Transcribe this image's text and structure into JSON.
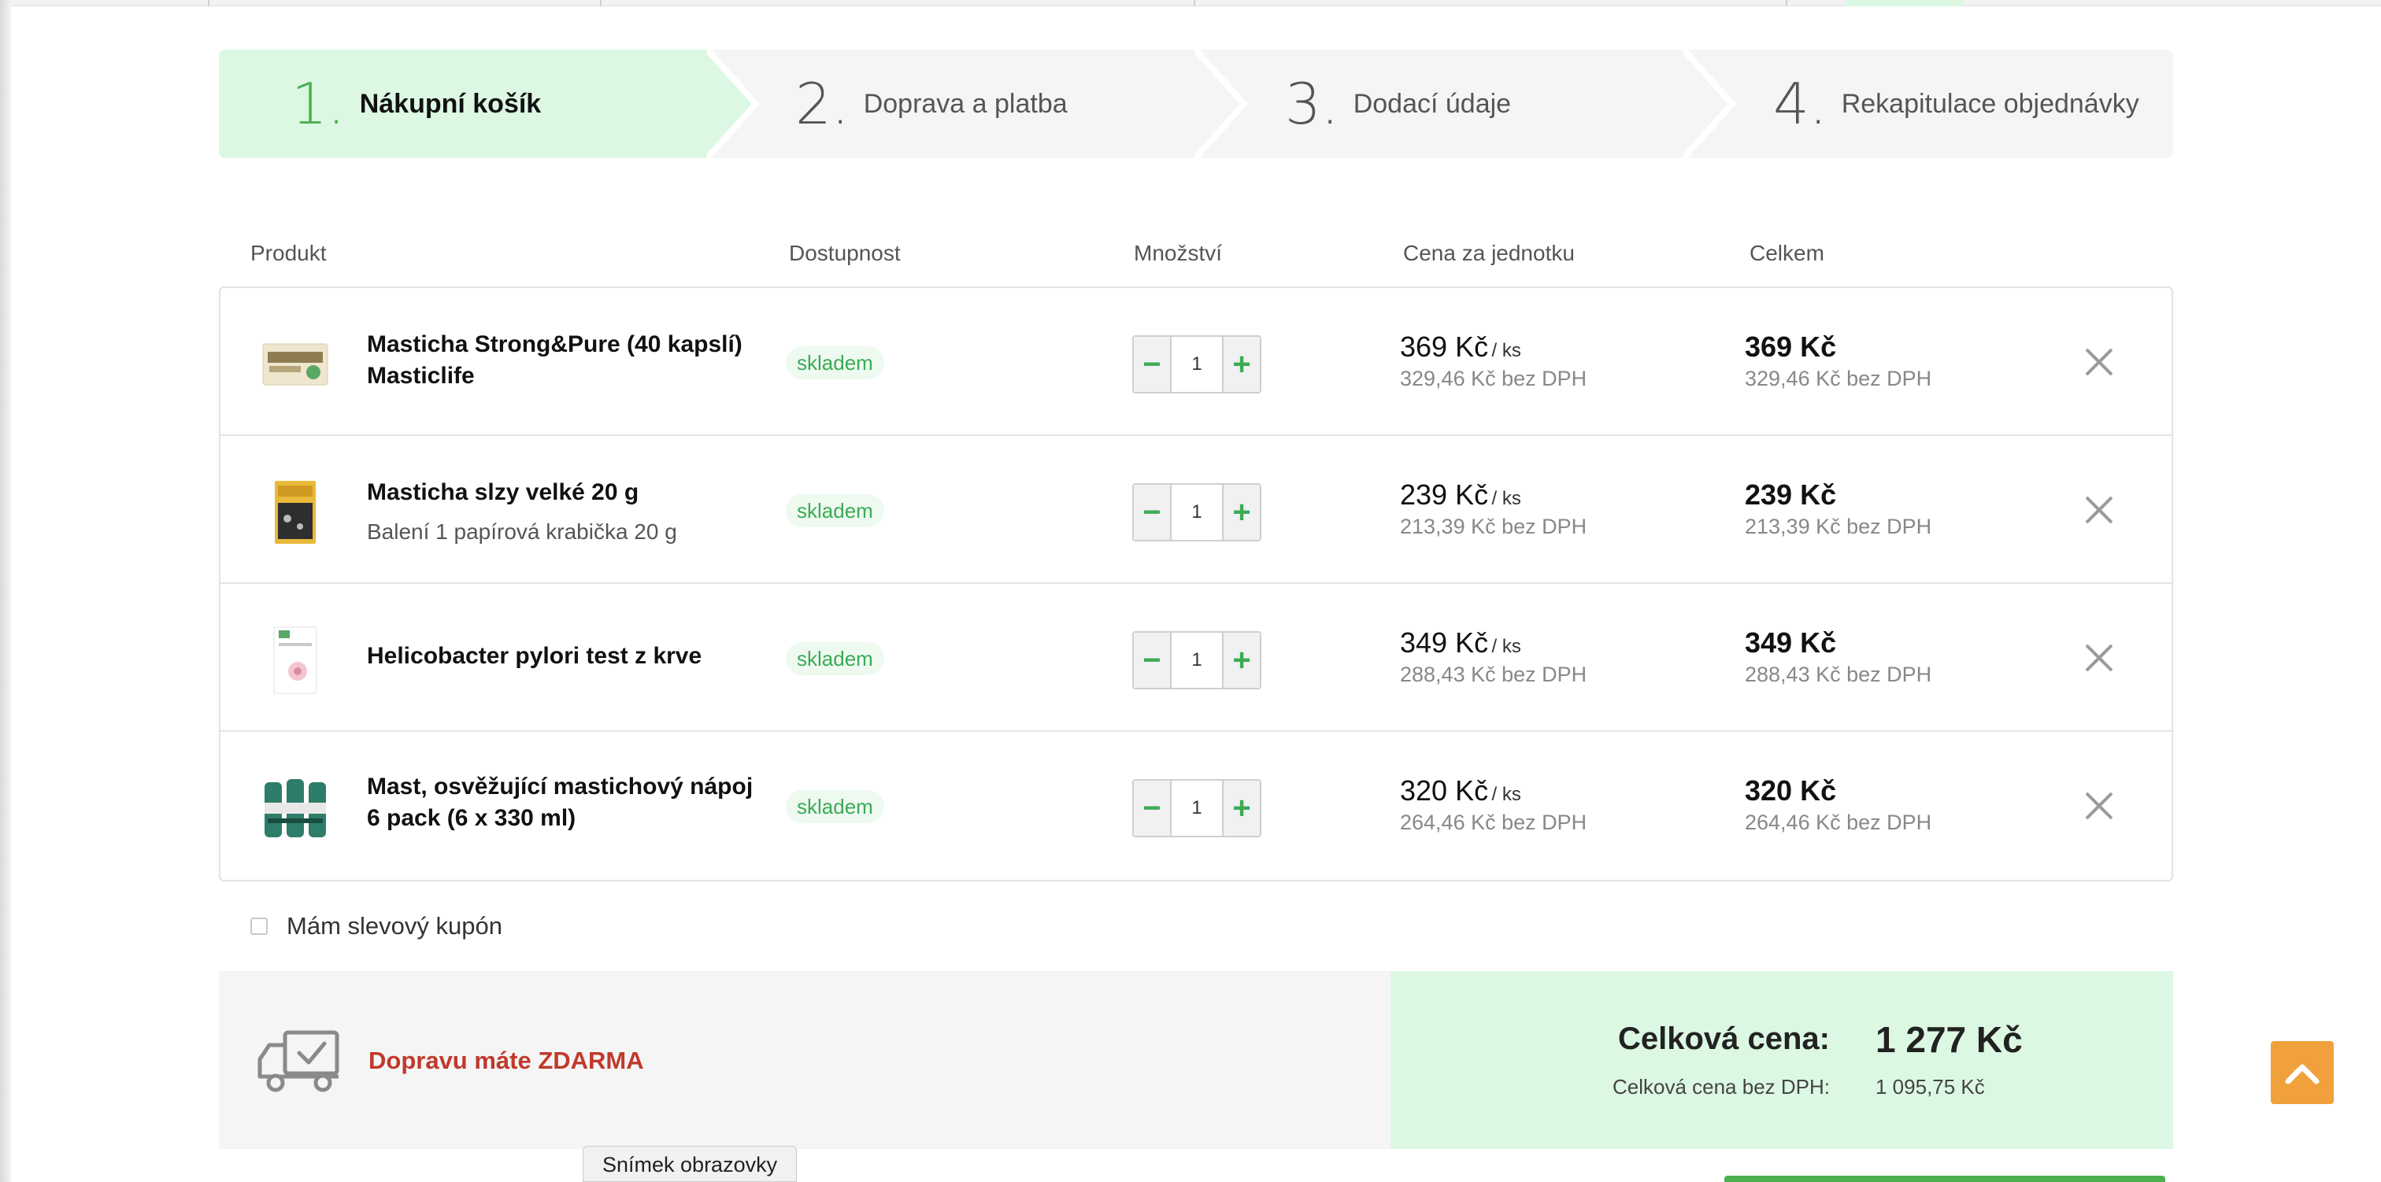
{
  "steps": [
    {
      "number": "1.",
      "label": "Nákupní košík"
    },
    {
      "number": "2.",
      "label": "Doprava a platba"
    },
    {
      "number": "3.",
      "label": "Dodací údaje"
    },
    {
      "number": "4.",
      "label": "Rekapitulace objednávky"
    }
  ],
  "table": {
    "headers": {
      "product": "Produkt",
      "availability": "Dostupnost",
      "quantity": "Množství",
      "unit_price": "Cena za jednotku",
      "total": "Celkem"
    },
    "rows": [
      {
        "name": "Masticha Strong&Pure (40 kapslí) Masticlife",
        "variant": "",
        "stock": "skladem",
        "qty": "1",
        "price": "369 Kč",
        "unit": "/ ks",
        "price_net": "329,46 Kč bez DPH",
        "total": "369 Kč",
        "total_net": "329,46 Kč bez DPH"
      },
      {
        "name": "Masticha slzy velké 20 g",
        "variant": "Balení 1 papírová krabička 20 g",
        "stock": "skladem",
        "qty": "1",
        "price": "239 Kč",
        "unit": "/ ks",
        "price_net": "213,39 Kč bez DPH",
        "total": "239 Kč",
        "total_net": "213,39 Kč bez DPH"
      },
      {
        "name": "Helicobacter pylori test z krve",
        "variant": "",
        "stock": "skladem",
        "qty": "1",
        "price": "349 Kč",
        "unit": "/ ks",
        "price_net": "288,43 Kč bez DPH",
        "total": "349 Kč",
        "total_net": "288,43 Kč bez DPH"
      },
      {
        "name": "Mast, osvěžující mastichový nápoj 6 pack (6 x 330 ml)",
        "variant": "",
        "stock": "skladem",
        "qty": "1",
        "price": "320 Kč",
        "unit": "/ ks",
        "price_net": "264,46 Kč bez DPH",
        "total": "320 Kč",
        "total_net": "264,46 Kč bez DPH"
      }
    ]
  },
  "coupon": {
    "label": "Mám slevový kupón"
  },
  "summary": {
    "shipping_text": "Dopravu máte ZDARMA",
    "total_label": "Celková cena:",
    "total_value": "1 277 Kč",
    "net_label": "Celková cena bez DPH:",
    "net_value": "1 095,75 Kč"
  },
  "tooltip": "Snímek obrazovky",
  "icons": {
    "minus": "minus-icon",
    "plus": "plus-icon",
    "remove": "close-icon",
    "truck": "delivery-truck-icon",
    "scroll_top": "chevron-up-icon"
  },
  "colors": {
    "accent_green": "#4caf50",
    "active_step_bg": "#dcf8e3",
    "free_shipping_red": "#c0392b",
    "scroll_button": "#f0a13b"
  }
}
